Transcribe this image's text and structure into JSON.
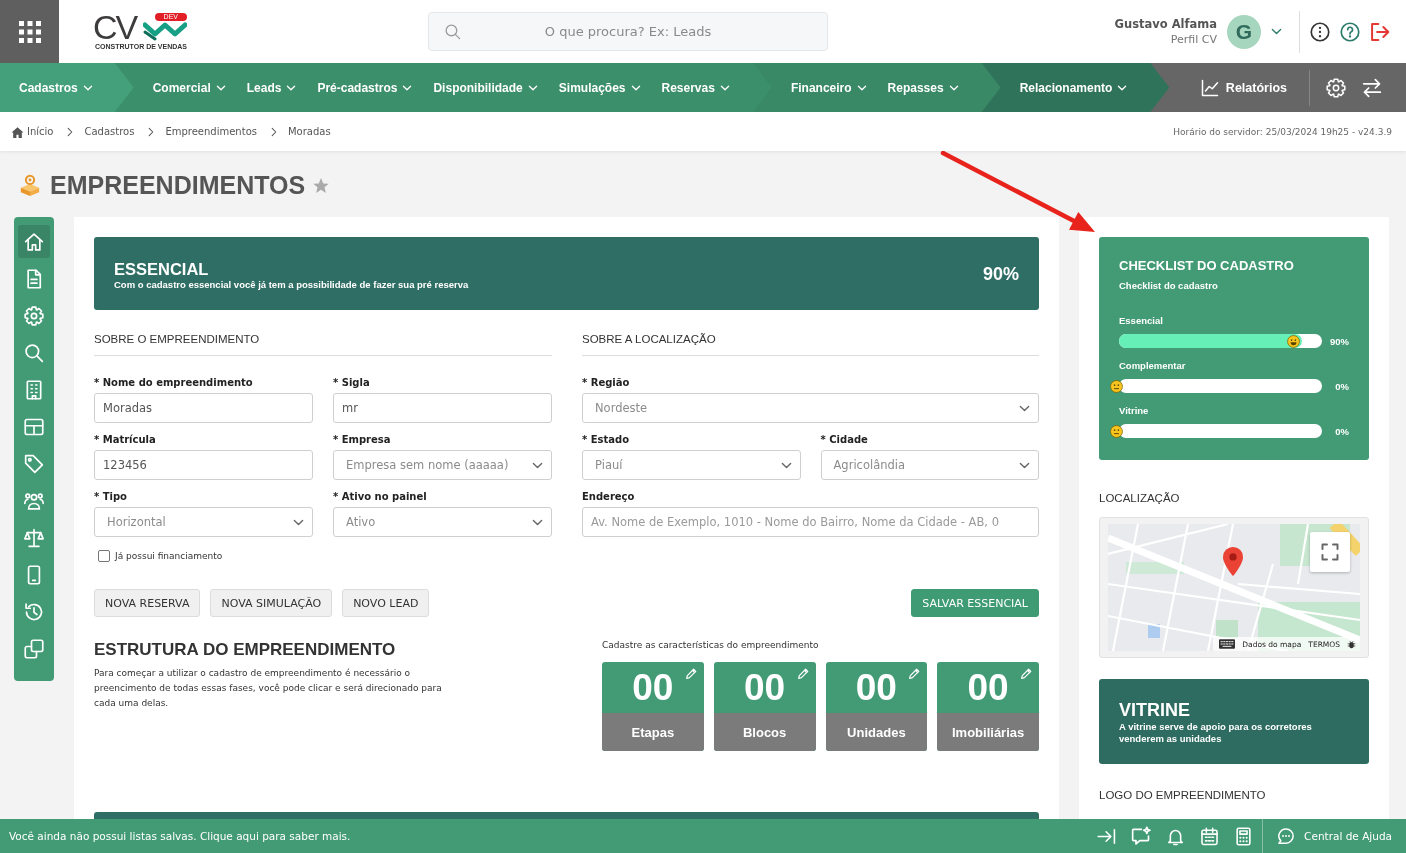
{
  "header": {
    "logo": {
      "mark": "CV",
      "badge": "DEV",
      "tagline": "CONSTRUTOR DE VENDAS"
    },
    "search": {
      "placeholder": "O que procura? Ex: Leads"
    },
    "user": {
      "name": "Gustavo Alfama",
      "role": "Perfil CV",
      "initial": "G"
    }
  },
  "nav": {
    "groups": [
      {
        "color": "#44a07b",
        "items": [
          "Cadastros"
        ]
      },
      {
        "color": "#3c8f6b",
        "items": [
          "Comercial",
          "Leads",
          "Pré-cadastros",
          "Disponibilidade",
          "Simulações",
          "Reservas"
        ]
      },
      {
        "color": "#398866",
        "items": [
          "Financeiro",
          "Repasses"
        ]
      },
      {
        "color": "#30735b",
        "items": [
          "Relacionamento"
        ]
      }
    ],
    "reports": "Relatórios"
  },
  "breadcrumb": {
    "items": [
      "Início",
      "Cadastros",
      "Empreendimentos",
      "Moradas"
    ],
    "server_info": "Horário do servidor: 25/03/2024 19h25 - v24.3.9"
  },
  "page": {
    "title": "EMPREENDIMENTOS",
    "favorite": false
  },
  "sidebar": {
    "items": [
      {
        "kind": "home",
        "selected": true
      },
      {
        "kind": "document",
        "selected": false
      },
      {
        "kind": "settings",
        "selected": false
      },
      {
        "kind": "search",
        "selected": false
      },
      {
        "kind": "building",
        "selected": false
      },
      {
        "kind": "table",
        "selected": false
      },
      {
        "kind": "tag",
        "selected": false
      },
      {
        "kind": "people",
        "selected": false
      },
      {
        "kind": "scale",
        "selected": false
      },
      {
        "kind": "mobile",
        "selected": false
      },
      {
        "kind": "history",
        "selected": false
      },
      {
        "kind": "copy",
        "selected": false
      }
    ]
  },
  "essential": {
    "title": "ESSENCIAL",
    "subtitle": "Com o cadastro essencial você já tem a possibilidade de fazer sua pré reserva",
    "percent": "90%"
  },
  "about": {
    "heading": "SOBRE O EMPREENDIMENTO",
    "rows": [
      [
        {
          "kind": "input",
          "label": "* Nome do empreendimento",
          "value": "Moradas"
        },
        {
          "kind": "input",
          "label": "* Sigla",
          "value": "mr"
        }
      ],
      [
        {
          "kind": "input",
          "label": "* Matrícula",
          "value": "123456"
        },
        {
          "kind": "select",
          "label": "* Empresa",
          "value": "Empresa sem nome (aaaaa)"
        }
      ],
      [
        {
          "kind": "select",
          "label": "* Tipo",
          "value": "Horizontal"
        },
        {
          "kind": "select",
          "label": "* Ativo no painel",
          "value": "Ativo"
        }
      ]
    ],
    "checkbox": {
      "label": "Já possui financiamento",
      "checked": false
    }
  },
  "location": {
    "heading": "SOBRE A LOCALIZAÇÃO",
    "rows": [
      [
        {
          "kind": "select",
          "label": "* Região",
          "value": "Nordeste"
        }
      ],
      [
        {
          "kind": "select",
          "label": "* Estado",
          "value": "Piauí"
        },
        {
          "kind": "select",
          "label": "* Cidade",
          "value": "Agricolândia"
        }
      ],
      [
        {
          "kind": "input",
          "label": "Endereço",
          "placeholder": "Av. Nome de Exemplo, 1010 - Nome do Bairro, Nome da Cidade - AB, 0"
        }
      ]
    ]
  },
  "actions": {
    "buttons": [
      "NOVA RESERVA",
      "NOVA SIMULAÇÃO",
      "NOVO LEAD"
    ],
    "save": "SALVAR ESSENCIAL"
  },
  "structure": {
    "title": "ESTRUTURA DO EMPREENDIMENTO",
    "description": "Para começar a utilizar o cadastro de empreendimento é necessário o preencimento de todas essas fases, você pode clicar e será direcionado para cada uma delas.",
    "caption": "Cadastre as características do empreendimento",
    "tiles": [
      {
        "count": "00",
        "label": "Etapas"
      },
      {
        "count": "00",
        "label": "Blocos"
      },
      {
        "count": "00",
        "label": "Unidades"
      },
      {
        "count": "00",
        "label": "Imobiliárias"
      }
    ]
  },
  "checklist": {
    "title": "CHECKLIST DO CADASTRO",
    "subtitle": "Checklist do cadastro",
    "items": [
      {
        "label": "Essencial",
        "level": 0.9,
        "reading": "90%"
      },
      {
        "label": "Complementar",
        "level": 0,
        "reading": "0%"
      },
      {
        "label": "Vitrine",
        "level": 0,
        "reading": "0%"
      }
    ]
  },
  "map_section": {
    "heading": "LOCALIZAÇÃO",
    "attribution": [
      "Dados do mapa",
      "TERMOS"
    ]
  },
  "showcase": {
    "title": "VITRINE",
    "text": "A vitrine serve de apoio para os corretores venderem as unidades"
  },
  "logo_section": {
    "heading": "LOGO DO EMPREENDIMENTO"
  },
  "footer": {
    "message": "Você ainda não possui listas salvas. Clique aqui para saber mais.",
    "help": "Central de Ajuda"
  }
}
